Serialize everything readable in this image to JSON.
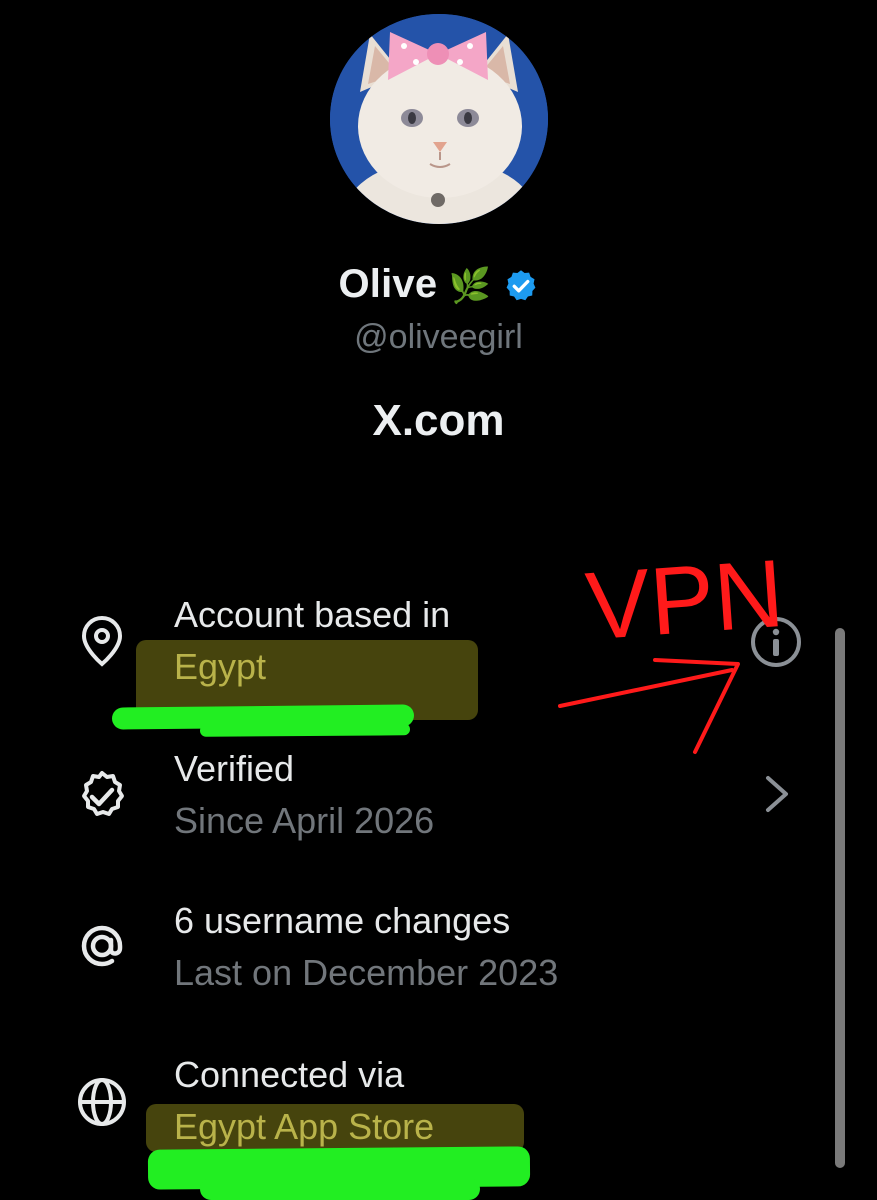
{
  "profile": {
    "name": "Olive",
    "name_emoji": "🌿",
    "handle": "@oliveegirl",
    "site": "X.com",
    "verified_badge_color": "#1d9bf0"
  },
  "rows": [
    {
      "icon": "location-pin-icon",
      "title": "Account based in",
      "subtitle": "Egypt",
      "trailing": "info-icon"
    },
    {
      "icon": "verified-badge-icon",
      "title": "Verified",
      "subtitle": "Since April 2026",
      "trailing": "chevron-right-icon"
    },
    {
      "icon": "at-sign-icon",
      "title": "6 username changes",
      "subtitle": "Last on December 2023",
      "trailing": ""
    },
    {
      "icon": "globe-icon",
      "title": "Connected via",
      "subtitle": "Egypt App Store",
      "trailing": ""
    }
  ],
  "annotation": {
    "text": "VPN",
    "color": "#ff1a1a",
    "highlight_yellow": "#807c18",
    "highlight_green": "#22ee22"
  }
}
